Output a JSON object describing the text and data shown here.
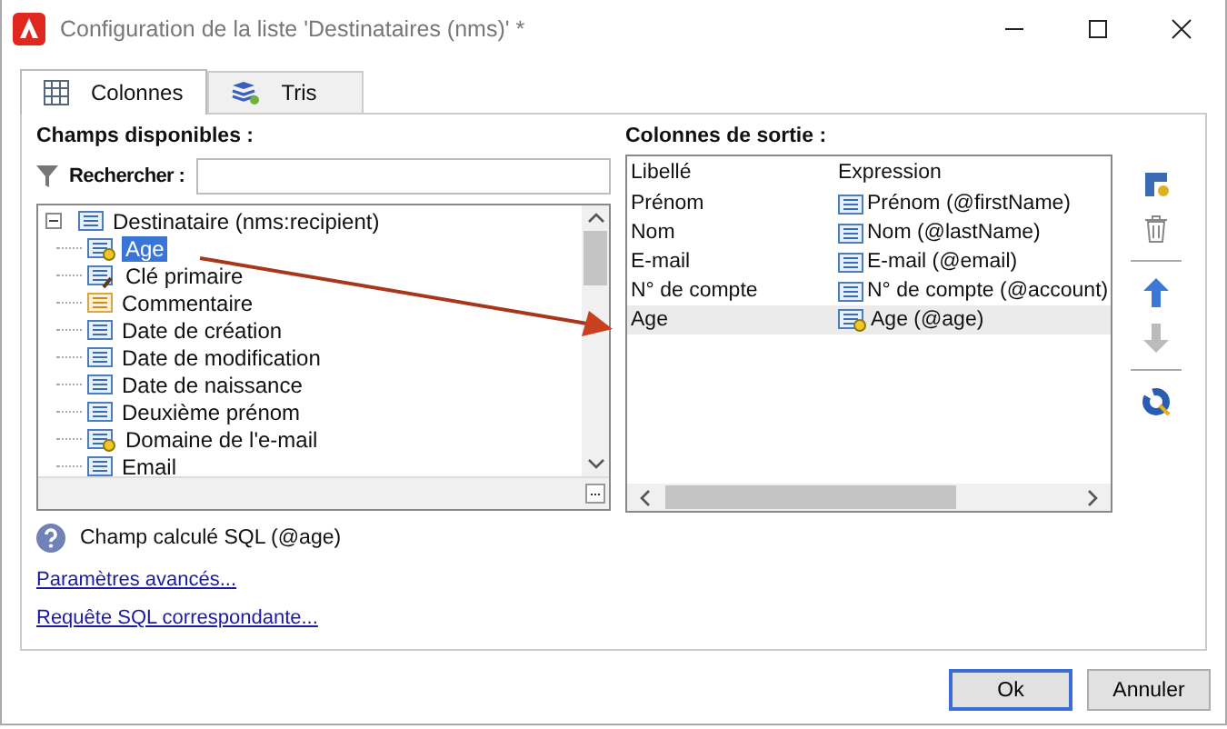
{
  "window": {
    "title": "Configuration de la liste 'Destinataires (nms)' *"
  },
  "tabs": [
    {
      "label": "Colonnes",
      "kind": "grid",
      "selected": true
    },
    {
      "label": "Tris",
      "kind": "sort",
      "selected": false
    }
  ],
  "fields_panel": {
    "heading": "Champs disponibles :",
    "search": {
      "label": "Rechercher :"
    },
    "tree": {
      "label": "Destinataire (nms:recipient)",
      "expanded": true,
      "children": [
        {
          "label": "Age",
          "kind": "calc",
          "selected": true
        },
        {
          "label": "Clé primaire",
          "kind": "key",
          "selected": false
        },
        {
          "label": "Commentaire",
          "kind": "memo",
          "selected": false
        },
        {
          "label": "Date de création",
          "kind": "field",
          "selected": false
        },
        {
          "label": "Date de modification",
          "kind": "field",
          "selected": false
        },
        {
          "label": "Date de naissance",
          "kind": "field",
          "selected": false
        },
        {
          "label": "Deuxième prénom",
          "kind": "field",
          "selected": false
        },
        {
          "label": "Domaine de l'e-mail",
          "kind": "calc",
          "selected": false
        },
        {
          "label": "Email",
          "kind": "field",
          "selected": false
        }
      ]
    }
  },
  "output_panel": {
    "heading": "Colonnes de sortie :",
    "columns": [
      "Libellé",
      "Expression"
    ],
    "rows": [
      {
        "label": "Prénom",
        "expression": "Prénom (@firstName)",
        "kind": "field",
        "selected": false
      },
      {
        "label": "Nom",
        "expression": "Nom (@lastName)",
        "kind": "field",
        "selected": false
      },
      {
        "label": "E-mail",
        "expression": "E-mail (@email)",
        "kind": "field",
        "selected": false
      },
      {
        "label": "N° de compte",
        "expression": "N° de compte (@account)",
        "kind": "field",
        "selected": false
      },
      {
        "label": "Age",
        "expression": "Age (@age)",
        "kind": "calc",
        "selected": true
      }
    ]
  },
  "info": {
    "text": "Champ calculé SQL (@age)"
  },
  "links": [
    "Paramètres avancés...",
    "Requête SQL correspondante..."
  ],
  "buttons": [
    {
      "label": "Ok",
      "default": true
    },
    {
      "label": "Annuler",
      "default": false
    }
  ]
}
